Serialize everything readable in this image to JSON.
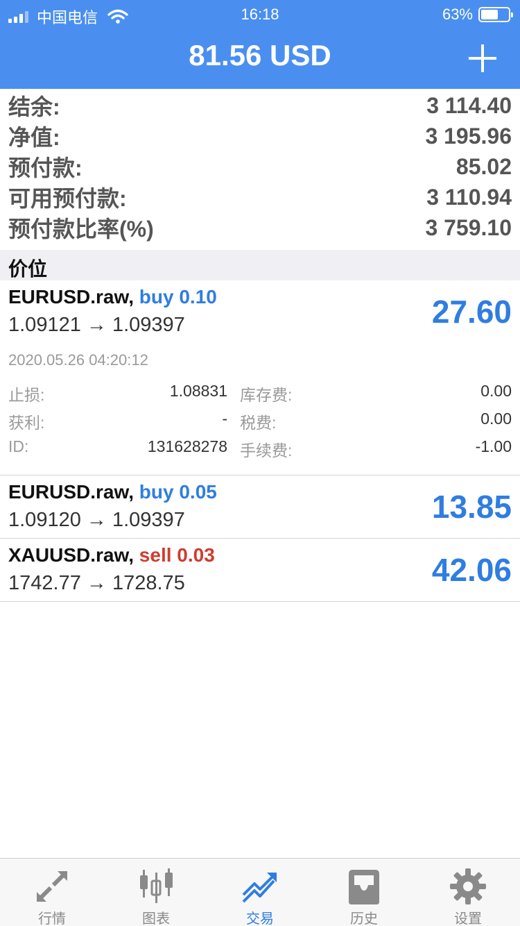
{
  "status_bar": {
    "carrier": "中国电信",
    "time": "16:18",
    "battery": "63%",
    "battery_level": 0.63
  },
  "header": {
    "title": "81.56 USD",
    "add_icon": "plus-icon"
  },
  "summary": [
    {
      "label": "结余:",
      "value": "3 114.40"
    },
    {
      "label": "净值:",
      "value": "3 195.96"
    },
    {
      "label": "预付款:",
      "value": "85.02"
    },
    {
      "label": "可用预付款:",
      "value": "3 110.94"
    },
    {
      "label": "预付款比率(%)",
      "value": "3 759.10"
    }
  ],
  "section": {
    "title": "价位"
  },
  "positions": [
    {
      "symbol": "EURUSD.raw,",
      "type": "buy 0.10",
      "prices": "1.09121 → 1.09397",
      "profit": "27.60",
      "details": {
        "date": "2020.05.26 04:20:12",
        "stop_loss_label": "止损:",
        "stop_loss": "1.08831",
        "swap_label": "库存费:",
        "swap": "0.00",
        "take_profit_label": "获利:",
        "take_profit": "-",
        "tax_label": "税费:",
        "tax": "0.00",
        "id_label": "ID:",
        "id": "131628278",
        "commission_label": "手续费:",
        "commission": "-1.00"
      }
    },
    {
      "symbol": "EURUSD.raw,",
      "type": "buy 0.05",
      "prices": "1.09120 → 1.09397",
      "profit": "13.85"
    },
    {
      "symbol": "XAUUSD.raw,",
      "type": "sell 0.03",
      "prices": "1742.77 → 1728.75",
      "profit": "42.06"
    }
  ],
  "tabbar": [
    {
      "label": "行情",
      "icon": "quotes-arrows-icon"
    },
    {
      "label": "图表",
      "icon": "candlestick-chart-icon"
    },
    {
      "label": "交易",
      "icon": "trade-trend-icon",
      "active": true
    },
    {
      "label": "历史",
      "icon": "history-inbox-icon"
    },
    {
      "label": "设置",
      "icon": "gear-icon"
    }
  ],
  "colors": {
    "header_bg": "#4a8ff0",
    "buy": "#2f7de1",
    "sell": "#d03b2f",
    "profit": "#2f7de1",
    "tab_active": "#2f7de1"
  }
}
